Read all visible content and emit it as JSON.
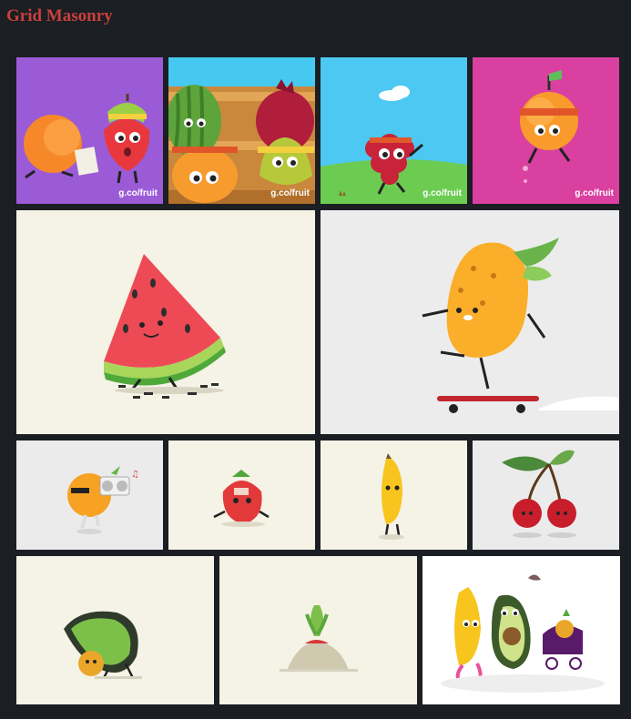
{
  "page": {
    "title": "Grid Masonry"
  },
  "colors": {
    "background": "#1b1e22",
    "title": "#c9403c",
    "caption": "#ffffff"
  },
  "tiles": [
    {
      "name": "tile-orange-strawberry",
      "illustration": "orange and strawberry characters",
      "caption": "g.co/fruit",
      "background": "#9b5bd6"
    },
    {
      "name": "tile-fruit-crate",
      "illustration": "watermelon pomegranate pear and orange in crate",
      "caption": "g.co/fruit",
      "background": "#45c9f0"
    },
    {
      "name": "tile-raspberry",
      "illustration": "raspberry character jogging",
      "caption": "g.co/fruit",
      "background": "#4cc8f2"
    },
    {
      "name": "tile-orange-jogger",
      "illustration": "orange character jogging",
      "caption": "g.co/fruit",
      "background": "#d9409f"
    },
    {
      "name": "tile-watermelon",
      "illustration": "watermelon slice walking",
      "background": "#f5f2e6"
    },
    {
      "name": "tile-mango",
      "illustration": "mango skateboarding",
      "background": "#ececec"
    },
    {
      "name": "tile-orange-boombox",
      "illustration": "orange with boombox",
      "background": "#ebebeb"
    },
    {
      "name": "tile-strawberry",
      "illustration": "strawberry character",
      "background": "#f5f2e6"
    },
    {
      "name": "tile-banana",
      "illustration": "banana character",
      "background": "#f5f2e6"
    },
    {
      "name": "tile-cherries",
      "illustration": "cherries characters",
      "background": "#ebebeb"
    },
    {
      "name": "tile-avocado-flip",
      "illustration": "avocado doing handstand",
      "background": "#f5f2e6"
    },
    {
      "name": "tile-radish",
      "illustration": "radish in soil",
      "background": "#f5f2e6"
    },
    {
      "name": "tile-fruit-family",
      "illustration": "banana avocado and stroller family",
      "background": "#ffffff"
    }
  ]
}
